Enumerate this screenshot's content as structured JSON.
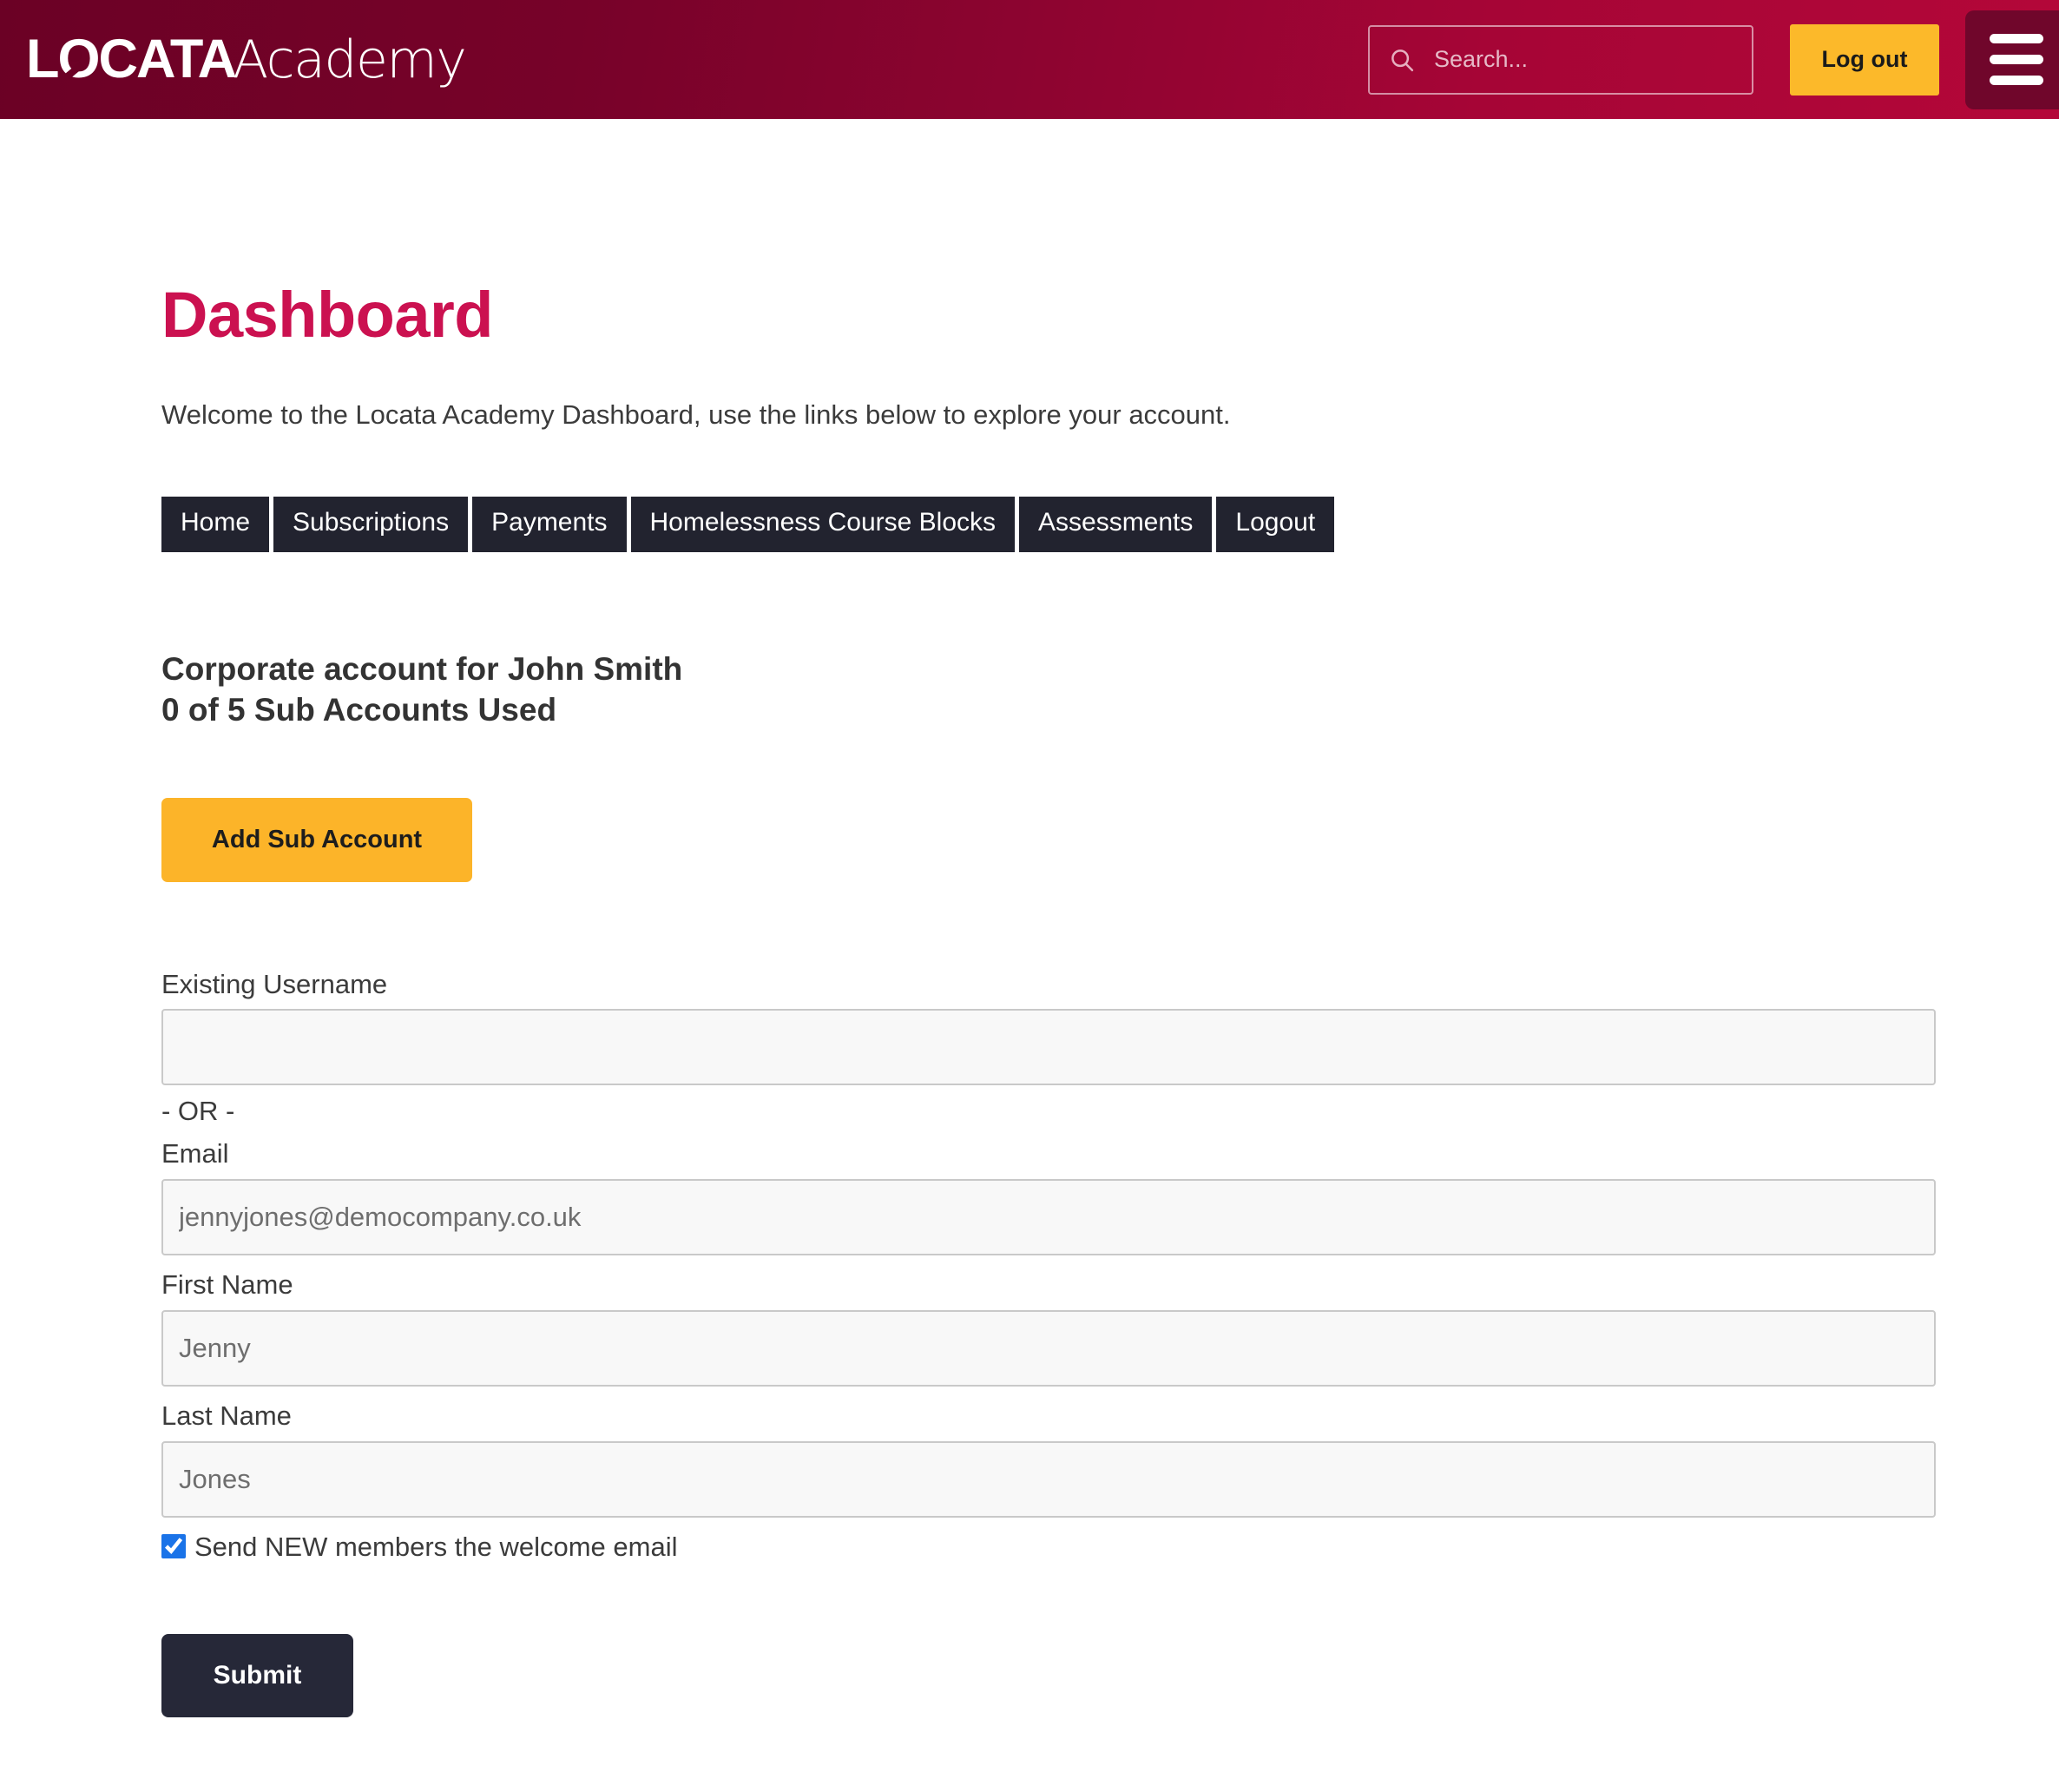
{
  "header": {
    "brand": {
      "primary": "LOCATA",
      "secondary": "Academy"
    },
    "search": {
      "placeholder": "Search...",
      "value": "",
      "icon": "search-icon"
    },
    "logout_label": "Log out",
    "menu_icon": "hamburger-menu-icon",
    "colors": {
      "gradient_start": "#6b0125",
      "gradient_end": "#b40739",
      "menu_button_bg": "#70062b",
      "logout_bg": "#fcb92a"
    }
  },
  "main": {
    "title": "Dashboard",
    "title_color": "#cb1150",
    "intro": "Welcome to the Locata Academy Dashboard, use the links below to explore your account.",
    "nav_tabs": [
      {
        "label": "Home"
      },
      {
        "label": "Subscriptions"
      },
      {
        "label": "Payments"
      },
      {
        "label": "Homelessness Course Blocks"
      },
      {
        "label": "Assessments"
      },
      {
        "label": "Logout"
      }
    ],
    "nav_tab_bg": "#22232f",
    "account": {
      "title": "Corporate account for John Smith",
      "usage": "0 of 5 Sub Accounts Used",
      "sub_accounts_used": 0,
      "sub_accounts_total": 5
    },
    "add_sub_account_label": "Add Sub Account",
    "add_sub_account_bg": "#fcb429"
  },
  "form": {
    "existing_username": {
      "label": "Existing Username",
      "value": "",
      "placeholder": ""
    },
    "or_separator": "- OR -",
    "email": {
      "label": "Email",
      "value": "",
      "placeholder": "jennyjones@democompany.co.uk"
    },
    "first_name": {
      "label": "First Name",
      "value": "",
      "placeholder": "Jenny"
    },
    "last_name": {
      "label": "Last Name",
      "value": "",
      "placeholder": "Jones"
    },
    "welcome_email": {
      "label": "Send NEW members the welcome email",
      "checked": true,
      "checkbox_color": "#1a73e8"
    },
    "submit_label": "Submit",
    "submit_bg": "#262838"
  }
}
